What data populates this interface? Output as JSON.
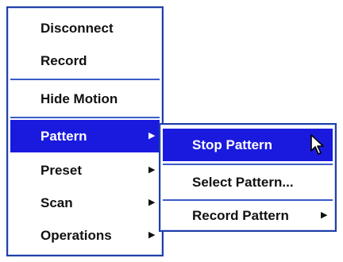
{
  "main_menu": {
    "items": [
      {
        "label": "Disconnect"
      },
      {
        "label": "Record"
      },
      {
        "label": "Hide Motion"
      },
      {
        "label": "Pattern",
        "arrow": "▶"
      },
      {
        "label": "Preset",
        "arrow": "▶"
      },
      {
        "label": "Scan",
        "arrow": "▶"
      },
      {
        "label": "Operations",
        "arrow": "▶"
      }
    ],
    "active_item": "Pattern"
  },
  "sub_menu": {
    "items": [
      {
        "label": "Stop Pattern"
      },
      {
        "label": "Select Pattern..."
      },
      {
        "label": "Record Pattern",
        "arrow": "▶"
      }
    ],
    "active_item": "Stop Pattern"
  },
  "colors": {
    "highlight": "#1a1adf",
    "border": "#1f3fa8",
    "text": "#111111"
  },
  "icons": {
    "cursor": "mouse-pointer-icon",
    "submenu_arrow": "triangle-right-icon"
  }
}
